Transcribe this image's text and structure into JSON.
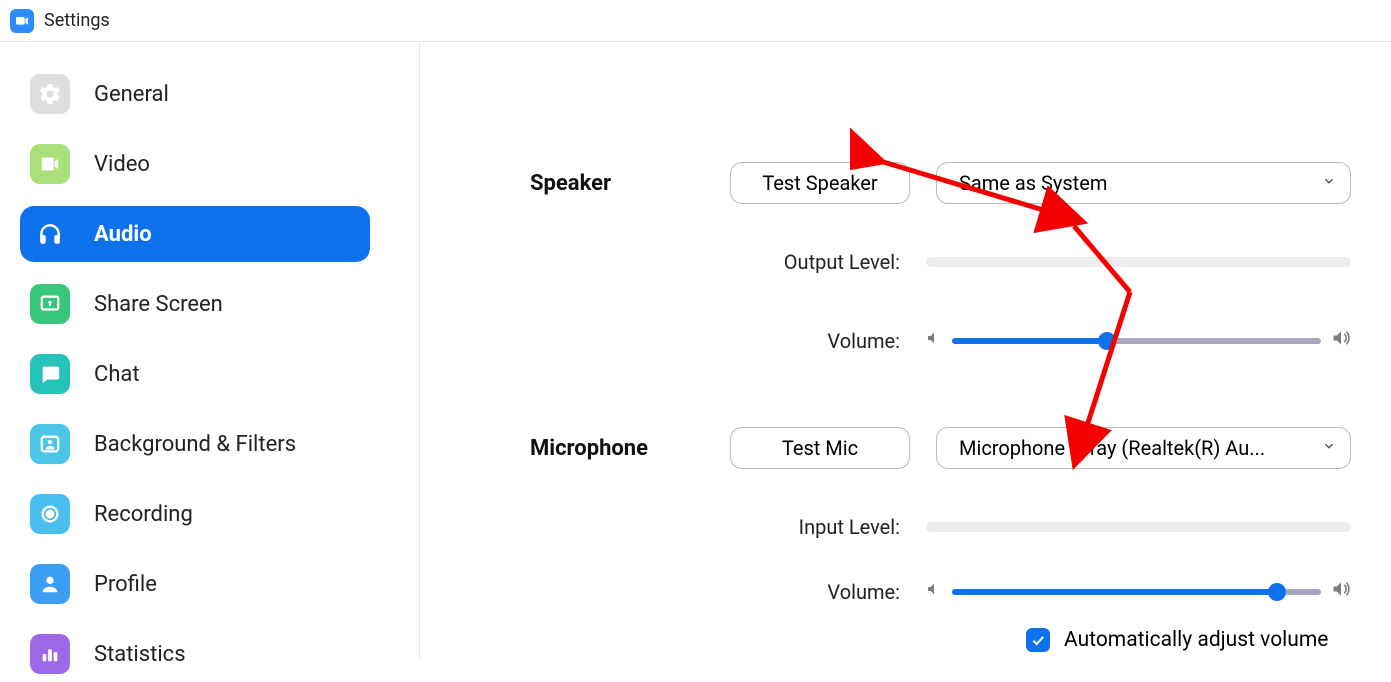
{
  "header": {
    "title": "Settings"
  },
  "sidebar": {
    "items": [
      {
        "label": "General"
      },
      {
        "label": "Video"
      },
      {
        "label": "Audio"
      },
      {
        "label": "Share Screen"
      },
      {
        "label": "Chat"
      },
      {
        "label": "Background & Filters"
      },
      {
        "label": "Recording"
      },
      {
        "label": "Profile"
      },
      {
        "label": "Statistics"
      }
    ],
    "active_index": 2
  },
  "audio": {
    "speaker": {
      "heading": "Speaker",
      "test_label": "Test Speaker",
      "device": "Same as System",
      "output_label": "Output Level:",
      "volume_label": "Volume:",
      "volume_pct": 42
    },
    "microphone": {
      "heading": "Microphone",
      "test_label": "Test Mic",
      "device": "Microphone Array (Realtek(R) Au...",
      "input_label": "Input Level:",
      "volume_label": "Volume:",
      "volume_pct": 88,
      "auto_adjust_label": "Automatically adjust volume",
      "auto_adjust_checked": true
    }
  }
}
